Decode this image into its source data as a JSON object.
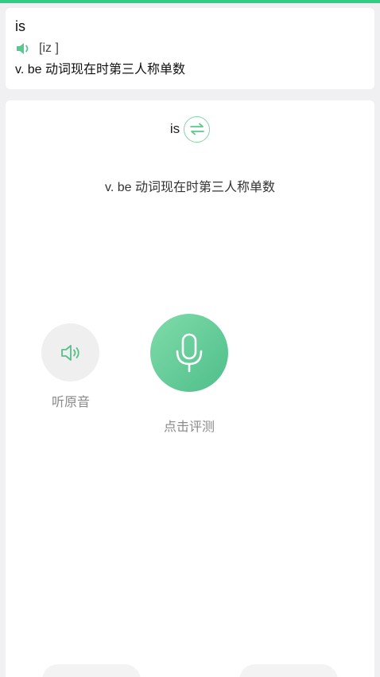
{
  "top_card": {
    "word": "is",
    "phonetic": "[iz ]",
    "meaning": "v. be 动词现在时第三人称单数",
    "speaker_icon": "speaker-filled-icon"
  },
  "practice": {
    "word": "is",
    "swap_icon": "swap-arrows-icon",
    "meaning": "v. be 动词现在时第三人称单数",
    "listen_label": "听原音",
    "listen_icon": "speaker-outline-icon",
    "record_label": "点击评测",
    "record_icon": "microphone-icon"
  },
  "colors": {
    "accent": "#2ecf82",
    "mic_gradient_start": "#7fdcaa",
    "mic_gradient_end": "#4fbe8a",
    "muted_text": "#8a8a8a"
  }
}
